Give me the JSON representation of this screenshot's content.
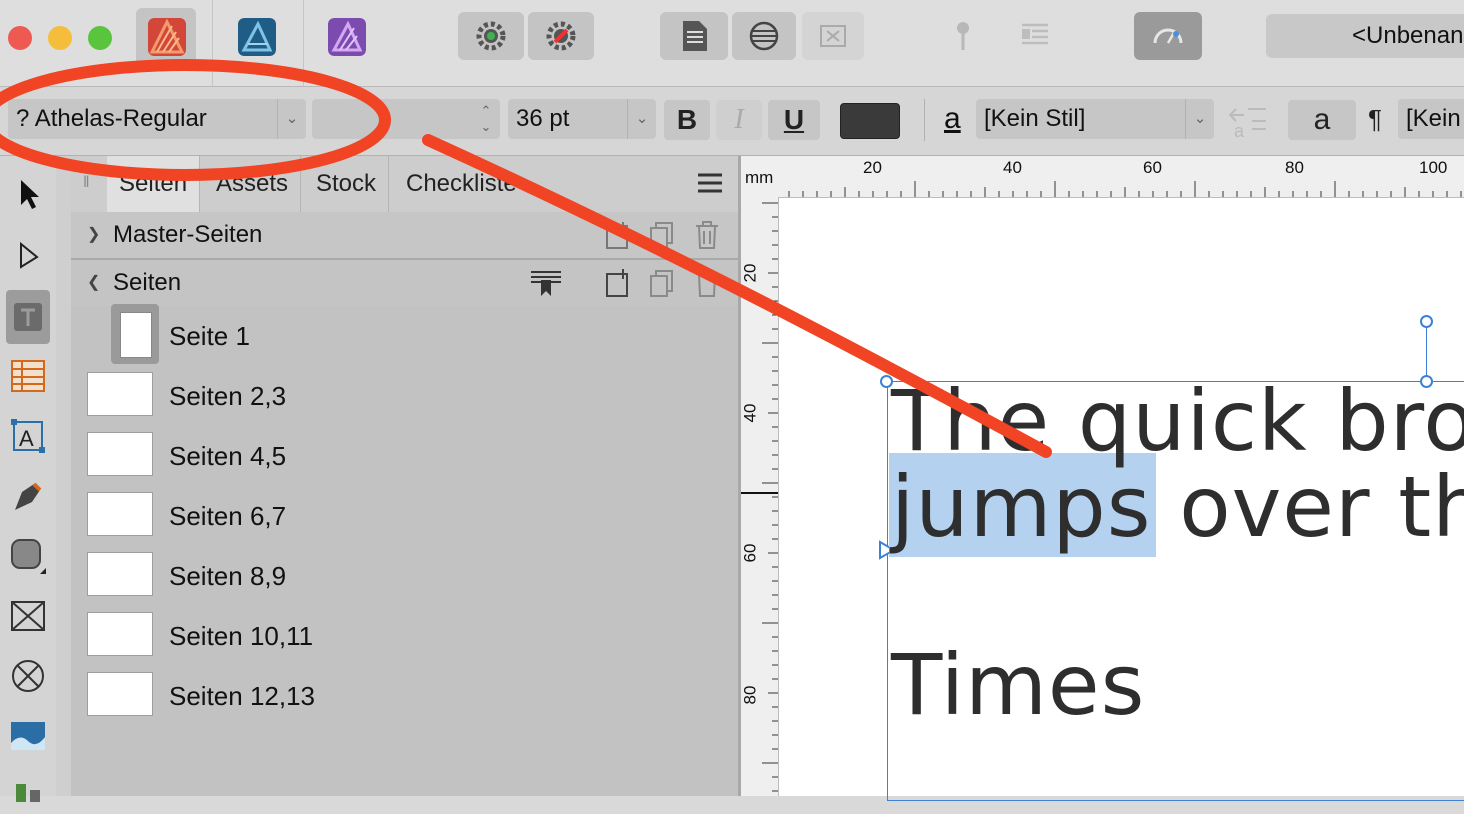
{
  "toolbar": {
    "document_name": "<Unbenan",
    "apps": [
      "affinity-publisher",
      "affinity-designer",
      "affinity-photo"
    ]
  },
  "context_bar": {
    "font_family": "? Athelas-Regular",
    "font_style": "",
    "font_size": "36 pt",
    "bold": "B",
    "italic": "I",
    "underline": "U",
    "char_style_icon": "a",
    "char_style": "[Kein Stil]",
    "caps_icon": "a",
    "pilcrow": "¶",
    "para_style": "[Kein"
  },
  "panel": {
    "tabs": [
      "Seiten",
      "Assets",
      "Stock",
      "Checkliste"
    ],
    "active_tab": "Seiten",
    "master_section": "Master-Seiten",
    "pages_section": "Seiten",
    "pages": [
      {
        "label": "Seite 1"
      },
      {
        "label": "Seiten 2,3"
      },
      {
        "label": "Seiten 4,5"
      },
      {
        "label": "Seiten 6,7"
      },
      {
        "label": "Seiten 8,9"
      },
      {
        "label": "Seiten 10,11"
      },
      {
        "label": "Seiten 12,13"
      }
    ]
  },
  "rulers": {
    "unit": "mm",
    "horizontal": [
      "20",
      "40",
      "60",
      "80",
      "100"
    ],
    "vertical": [
      "20",
      "40",
      "60",
      "80"
    ]
  },
  "canvas": {
    "line1": "The quick bro",
    "line2_selected": "jumps",
    "line2_rest": " over th",
    "line3": "Times"
  },
  "colors": {
    "annotation": "#f04424",
    "selection": "#b5d1f0",
    "frame": "#3b82d6"
  }
}
